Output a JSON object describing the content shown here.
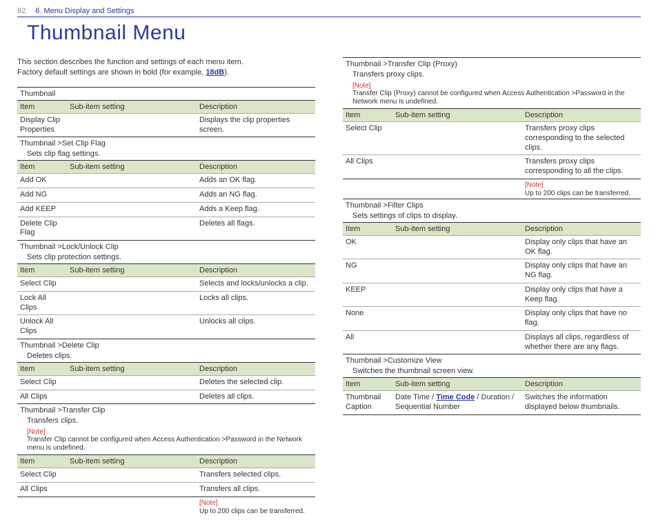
{
  "header": {
    "page_number": "92",
    "chapter": "6. Menu Display and Settings"
  },
  "title": "Thumbnail Menu",
  "intro_line1": "This section describes the function and settings of each menu item.",
  "intro_line2_a": "Factory default settings are shown in bold (for example, ",
  "intro_line2_link": "18dB",
  "intro_line2_b": ").",
  "columns_meta": {
    "item": "Item",
    "sub": "Sub-item setting",
    "desc": "Description"
  },
  "note_label": "[Note]",
  "sections": {
    "thumb": {
      "title": "Thumbnail",
      "rows": [
        {
          "item": "Display Clip Properties",
          "sub": "",
          "desc": "Displays the clip properties screen."
        }
      ]
    },
    "setflag": {
      "title": "Thumbnail >Set Clip Flag",
      "subtitle": "Sets clip flag settings.",
      "rows": [
        {
          "item": "Add OK",
          "sub": "",
          "desc": "Adds an OK flag."
        },
        {
          "item": "Add NG",
          "sub": "",
          "desc": "Adds an NG flag."
        },
        {
          "item": "Add KEEP",
          "sub": "",
          "desc": "Adds a Keep flag."
        },
        {
          "item": "Delete Clip Flag",
          "sub": "",
          "desc": "Deletes all flags."
        }
      ]
    },
    "lock": {
      "title": "Thumbnail >Lock/Unlock Clip",
      "subtitle": "Sets clip protection settings.",
      "rows": [
        {
          "item": "Select Clip",
          "sub": "",
          "desc": "Selects and locks/unlocks a clip."
        },
        {
          "item": "Lock All Clips",
          "sub": "",
          "desc": "Locks all clips."
        },
        {
          "item": "Unlock All Clips",
          "sub": "",
          "desc": "Unlocks all clips."
        }
      ]
    },
    "delete": {
      "title": "Thumbnail >Delete Clip",
      "subtitle": "Deletes clips.",
      "rows": [
        {
          "item": "Select Clip",
          "sub": "",
          "desc": "Deletes the selected clip."
        },
        {
          "item": "All Clips",
          "sub": "",
          "desc": "Deletes all clips."
        }
      ]
    },
    "transfer": {
      "title": "Thumbnail >Transfer Clip",
      "subtitle": "Transfers clips.",
      "note": "Transfer Clip cannot be configured when Access Authentication >Password in the Network menu is undefined.",
      "rows": [
        {
          "item": "Select Clip",
          "sub": "",
          "desc": "Transfers selected clips."
        },
        {
          "item": "All Clips",
          "sub": "",
          "desc": "Transfers all clips."
        }
      ],
      "end_note": "Up to 200 clips can be transferred."
    },
    "proxy": {
      "title": "Thumbnail >Transfer Clip (Proxy)",
      "subtitle": "Transfers proxy clips.",
      "note": "Transfer Clip (Proxy) cannot be configured when Access Authentication >Password in the Network menu is undefined.",
      "rows": [
        {
          "item": "Select Clip",
          "sub": "",
          "desc": "Transfers proxy clips corresponding to the selected clips."
        },
        {
          "item": "All Clips",
          "sub": "",
          "desc": "Transfers proxy clips corresponding to all the clips."
        }
      ],
      "end_note": "Up to 200 clips can be transferred."
    },
    "filter": {
      "title": "Thumbnail >Filter Clips",
      "subtitle": "Sets settings of clips to display.",
      "rows": [
        {
          "item": "OK",
          "sub": "",
          "desc": "Display only clips that have an OK flag."
        },
        {
          "item": "NG",
          "sub": "",
          "desc": "Display only clips that have an NG flag."
        },
        {
          "item": "KEEP",
          "sub": "",
          "desc": "Display only clips that have a Keep flag."
        },
        {
          "item": "None",
          "sub": "",
          "desc": "Display only clips that have no flag."
        },
        {
          "item": "All",
          "sub": "",
          "desc": "Displays all clips, regardless of whether there are any flags."
        }
      ]
    },
    "custom": {
      "title": "Thumbnail >Customize View",
      "subtitle": "Switches the thumbnail screen view.",
      "rows": [
        {
          "item": "Thumbnail Caption",
          "sub_pre": "Date Time / ",
          "sub_bold": "Time Code",
          "sub_post": " / Duration / Sequential Number",
          "desc": "Switches the information displayed below thumbnails."
        }
      ]
    }
  }
}
